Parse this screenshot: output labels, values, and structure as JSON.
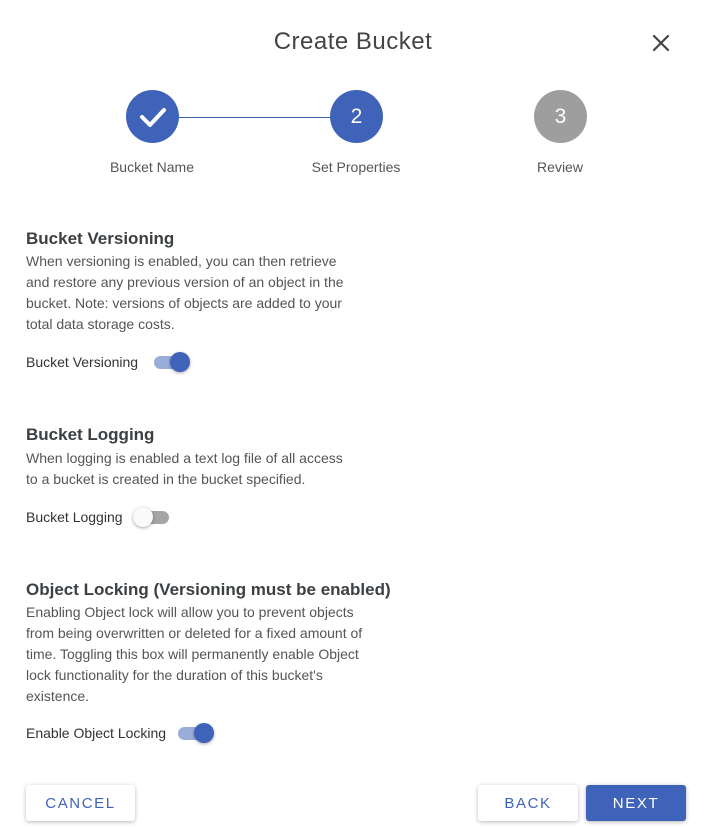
{
  "dialog": {
    "title": "Create Bucket",
    "close_icon": "close-icon"
  },
  "stepper": {
    "steps": [
      {
        "label": "Bucket Name",
        "marker": "",
        "state": "completed",
        "icon": "checkmark-icon"
      },
      {
        "label": "Set Properties",
        "marker": "2",
        "state": "active"
      },
      {
        "label": "Review",
        "marker": "3",
        "state": "pending"
      }
    ]
  },
  "sections": {
    "versioning": {
      "title": "Bucket Versioning",
      "description": "When versioning is enabled, you can then retrieve and restore any previous version of an object in the bucket. Note: versions of objects are added to your total data storage costs.",
      "toggle_label": "Bucket Versioning",
      "enabled": true
    },
    "logging": {
      "title": "Bucket Logging",
      "description": "When logging is enabled a text log file of all access to a bucket is created in the bucket specified.",
      "toggle_label": "Bucket Logging",
      "enabled": false
    },
    "locking": {
      "title": "Object Locking (Versioning must be enabled)",
      "description": "Enabling Object lock will allow you to prevent objects from being overwritten or deleted for a fixed amount of time. Toggling this box will permanently enable Object lock functionality for the duration of this bucket's existence.",
      "toggle_label": "Enable Object Locking",
      "enabled": true
    }
  },
  "footer": {
    "cancel_label": "CANCEL",
    "back_label": "BACK",
    "next_label": "NEXT"
  },
  "colors": {
    "primary": "#3f63b8",
    "pending": "#9e9e9e"
  }
}
